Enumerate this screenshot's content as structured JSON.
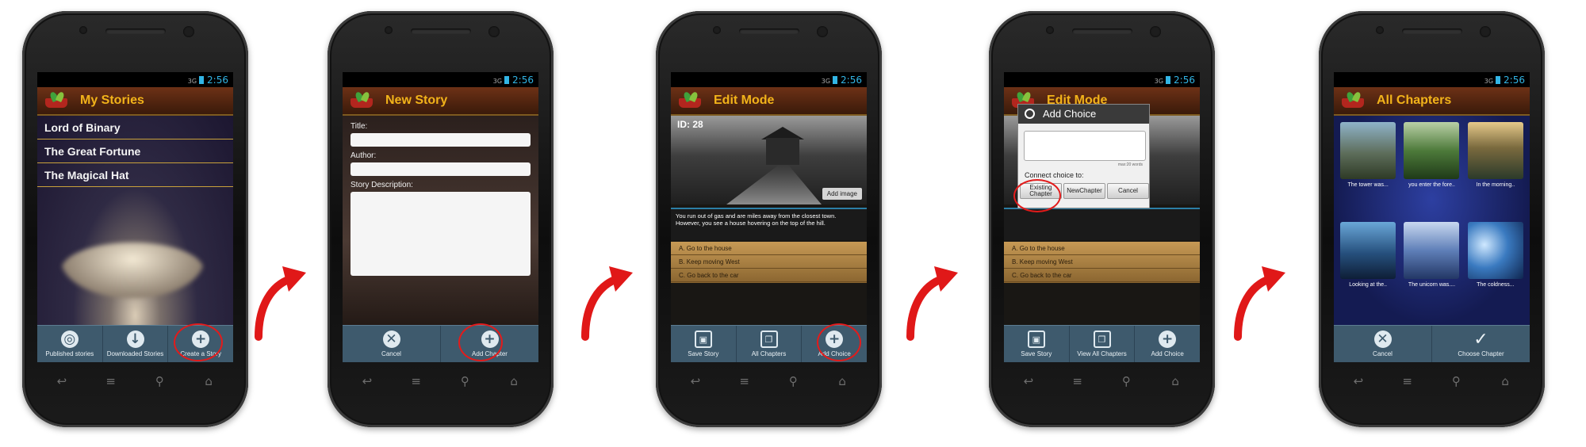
{
  "status": {
    "signal": "3G",
    "time": "2:56"
  },
  "screen1": {
    "title": "My Stories",
    "stories": [
      "Lord of Binary",
      "The Great Fortune",
      "The Magical Hat"
    ],
    "buttons": [
      "Published stories",
      "Downloaded Stories",
      "Create a Story"
    ]
  },
  "screen2": {
    "title": "New Story",
    "labels": {
      "title": "Title:",
      "author": "Author:",
      "description": "Story Description:"
    },
    "buttons": [
      "Cancel",
      "Add Chapter"
    ]
  },
  "screen3": {
    "title": "Edit Mode",
    "id": "ID: 28",
    "add_image": "Add image",
    "description": "You run out of gas and are miles away from the closest town. However, you see a house hovering on the top  of the hill.",
    "choices": [
      "A. Go to the house",
      "B. Keep moving West",
      "C. Go back to the car"
    ],
    "buttons": [
      "Save Story",
      "All Chapters",
      "Add Choice"
    ]
  },
  "screen4": {
    "title": "Edit Mode",
    "dialog": {
      "title": "Add Choice",
      "max_words": "max:20 words",
      "connect": "Connect choice to:",
      "buttons": [
        "Existing Chapter",
        "NewChapter",
        "Cancel"
      ]
    },
    "choices": [
      "A. Go to the house",
      "B. Keep moving West",
      "C. Go back to the car"
    ],
    "buttons": [
      "Save Story",
      "View All Chapters",
      "Add Choice"
    ]
  },
  "screen5": {
    "title": "All  Chapters",
    "chapters": [
      "The tower was...",
      "you enter the fore..",
      "In the morning..",
      "Looking at the..",
      "The unicorn was....",
      "The coldness..."
    ],
    "buttons": [
      "Cancel",
      "Choose Chapter"
    ]
  },
  "colors": {
    "accent_title": "#f2b31a",
    "titlebar": "#5a2812",
    "bottombar": "#3e5a6d",
    "highlight": "#e31b1b",
    "status_blue": "#32b5e5"
  }
}
